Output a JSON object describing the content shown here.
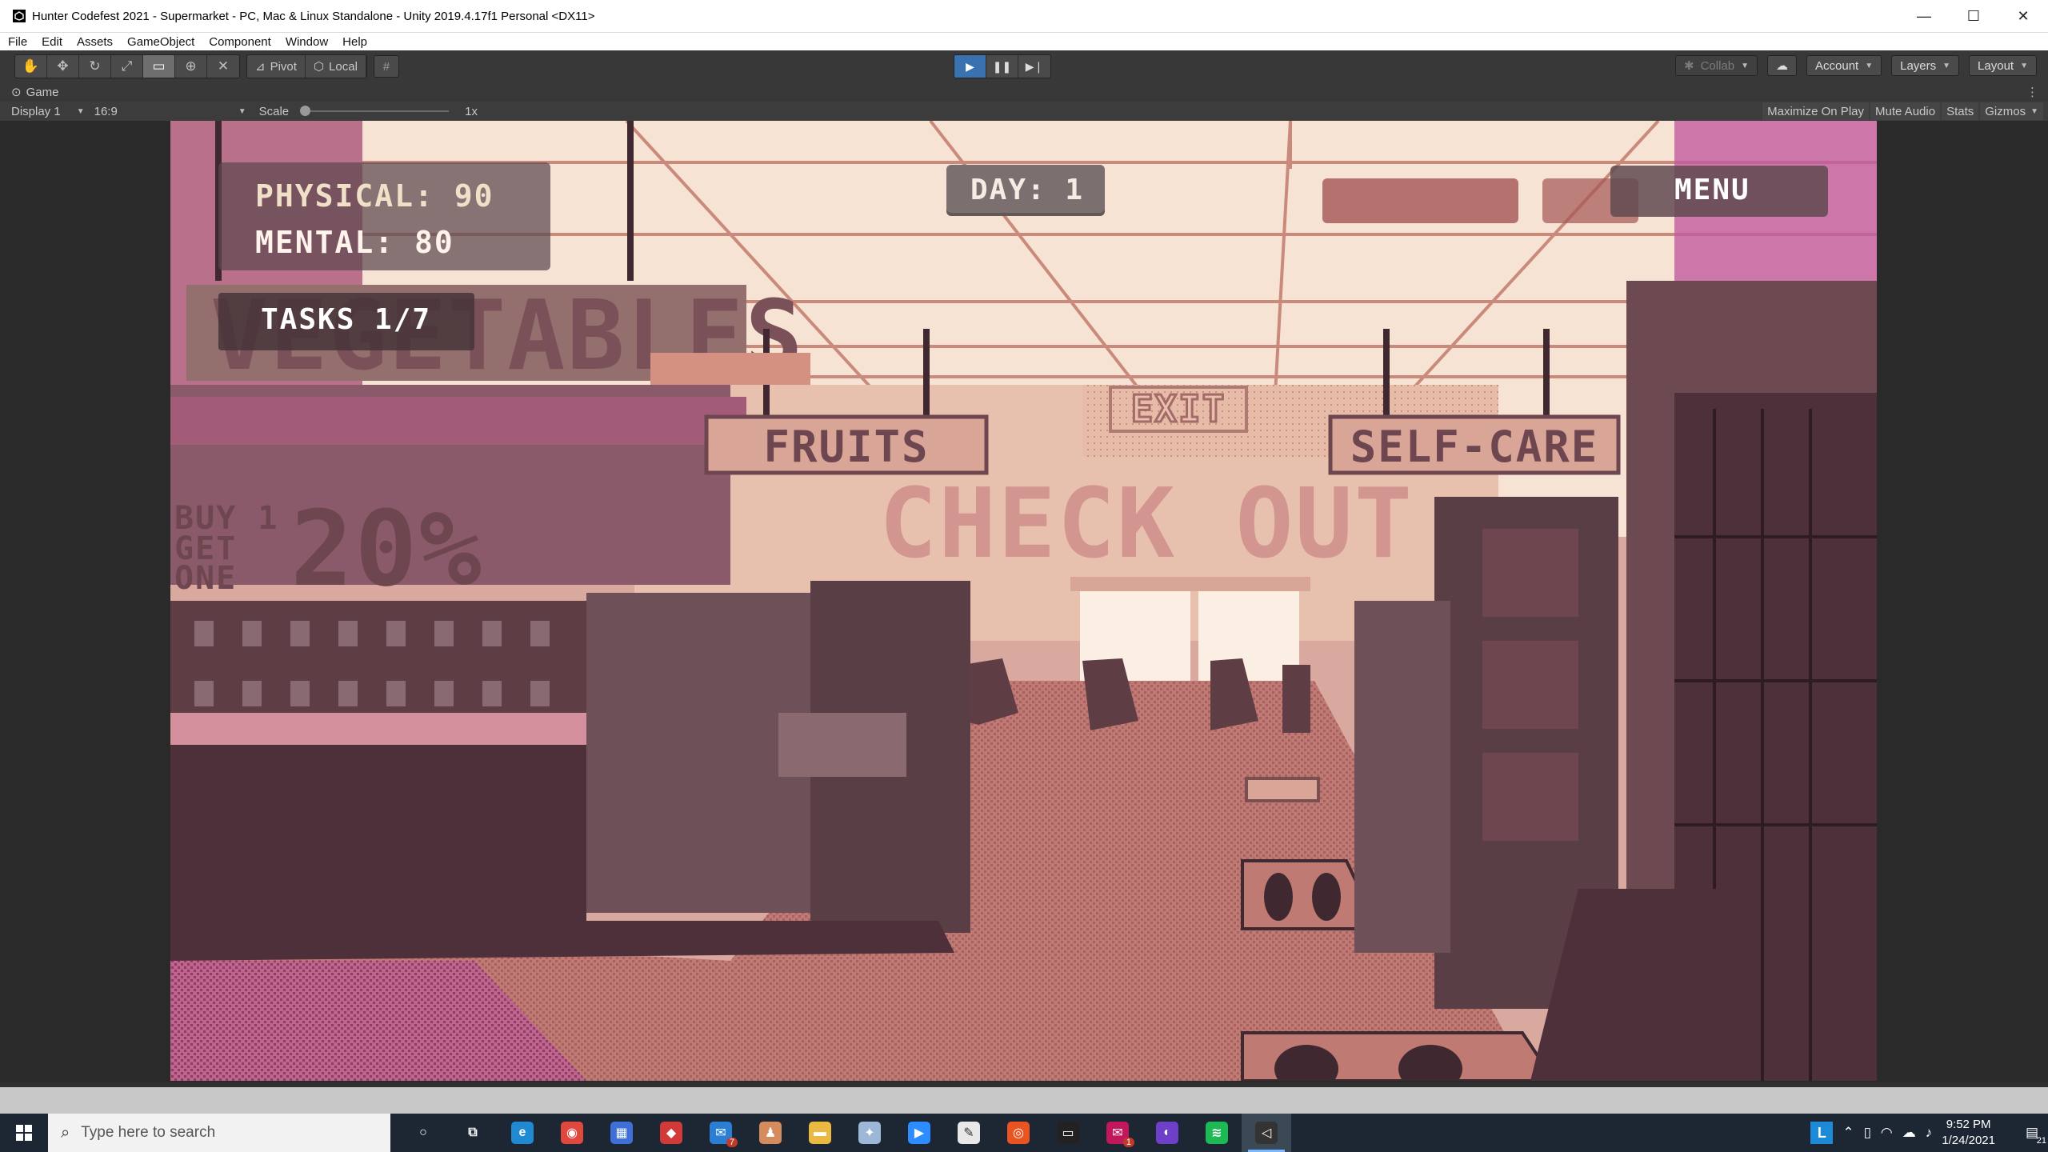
{
  "window": {
    "title": "Hunter Codefest 2021 - Supermarket - PC, Mac & Linux Standalone - Unity 2019.4.17f1 Personal <DX11>",
    "controls": {
      "minimize": "—",
      "maximize": "☐",
      "close": "✕"
    }
  },
  "menu": {
    "items": [
      "File",
      "Edit",
      "Assets",
      "GameObject",
      "Component",
      "Window",
      "Help"
    ]
  },
  "toolbar": {
    "tools": [
      "hand-tool",
      "move-tool",
      "rotate-tool",
      "scale-tool",
      "rect-tool",
      "transform-tool",
      "custom-tool"
    ],
    "active_tool": "rect-tool",
    "pivot_label": "Pivot",
    "local_label": "Local",
    "play_state": "playing",
    "collab_label": "Collab",
    "account_label": "Account",
    "layers_label": "Layers",
    "layout_label": "Layout"
  },
  "game_view": {
    "tab_label": "Game",
    "display": "Display 1",
    "aspect": "16:9",
    "scale_label": "Scale",
    "scale_value": "1x",
    "toggles": [
      "Maximize On Play",
      "Mute Audio",
      "Stats",
      "Gizmos"
    ]
  },
  "hud": {
    "physical": "PHYSICAL: 90",
    "mental": "MENTAL: 80",
    "tasks": "TASKS 1/7",
    "day": "DAY: 1",
    "menu": "MENU"
  },
  "scene": {
    "signs": {
      "vegetables": "VEGETABLES",
      "fruits": "FRUITS",
      "self_care": "SELF-CARE",
      "exit": "EXIT",
      "checkout": "CHECK OUT"
    },
    "promo": {
      "line1": "BUY 1",
      "line2": "GET",
      "line3": "ONE",
      "discount": "20%"
    },
    "palette": {
      "wall": "#e8c1ae",
      "ceiling": "#f5dfcf",
      "dark": "#5e3d45",
      "mid": "#8a5a5e",
      "floor": "#c77f78",
      "pink_accent": "#c05aa0"
    }
  },
  "taskbar": {
    "search_placeholder": "Type here to search",
    "apps": [
      {
        "name": "cortana",
        "color": "#1c2733",
        "glyph": "○"
      },
      {
        "name": "task-view",
        "color": "#1c2733",
        "glyph": "⧉"
      },
      {
        "name": "edge",
        "color": "#1f8ad2",
        "glyph": "e"
      },
      {
        "name": "chrome",
        "color": "#e0483e",
        "glyph": "◉"
      },
      {
        "name": "store",
        "color": "#3f6fd8",
        "glyph": "▦"
      },
      {
        "name": "app-red",
        "color": "#d23a3a",
        "glyph": "◆"
      },
      {
        "name": "mail",
        "color": "#2a7fd4",
        "glyph": "✉"
      },
      {
        "name": "game-app",
        "color": "#d68b5c",
        "glyph": "♟"
      },
      {
        "name": "file-explorer",
        "color": "#e9b941",
        "glyph": "▬"
      },
      {
        "name": "bird-app",
        "color": "#9db8d6",
        "glyph": "✦"
      },
      {
        "name": "zoom",
        "color": "#2d8cff",
        "glyph": "▶"
      },
      {
        "name": "notepad",
        "color": "#e8e8e8",
        "glyph": "✎"
      },
      {
        "name": "ubuntu",
        "color": "#e95420",
        "glyph": "◎"
      },
      {
        "name": "terminal",
        "color": "#222222",
        "glyph": "▭"
      },
      {
        "name": "messenger",
        "color": "#c2185b",
        "glyph": "✉"
      },
      {
        "name": "github",
        "color": "#6e40c9",
        "glyph": "◐"
      },
      {
        "name": "spotify",
        "color": "#1db954",
        "glyph": "≋"
      },
      {
        "name": "unity",
        "color": "#333333",
        "glyph": "◁"
      }
    ],
    "mail_badge": "7",
    "messenger_badge": "1",
    "tray_letter": "L",
    "time": "9:52 PM",
    "date": "1/24/2021",
    "notifications": "21"
  }
}
